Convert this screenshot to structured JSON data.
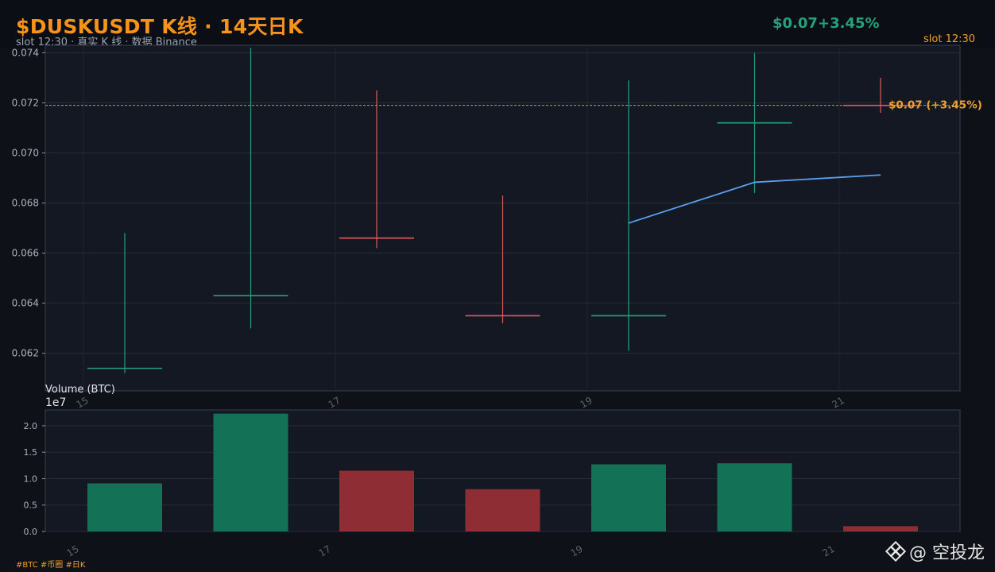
{
  "header": {
    "title": "$DUSKUSDT K线 · 14天日K",
    "subtitle": "slot 12:30 · 真实 K 线 · 数据 Binance",
    "price": "$0.07",
    "change": "+3.45%",
    "slot": "slot 12:30"
  },
  "footer": {
    "tags": "#BTC #币圈 #日K",
    "watermark": "@ 空投龙"
  },
  "colors": {
    "up": "#26a17b",
    "down": "#e05a5a",
    "up_volume": "#137256",
    "down_volume": "#8e2d34",
    "ma_line": "#5aa0f0",
    "accent": "#f0a030"
  },
  "chart_data": [
    {
      "type": "candlestick",
      "x": [
        "15",
        "16",
        "17",
        "18",
        "19",
        "20",
        "21"
      ],
      "x_tick_labels": [
        "15",
        "17",
        "19",
        "21"
      ],
      "open": [
        0.0614,
        0.0643,
        0.0666,
        0.0635,
        0.0635,
        0.0712,
        0.0719
      ],
      "high": [
        0.0668,
        0.0742,
        0.0725,
        0.0683,
        0.0729,
        0.074,
        0.073
      ],
      "low": [
        0.0612,
        0.063,
        0.0662,
        0.0632,
        0.0621,
        0.0684,
        0.0716
      ],
      "close": [
        0.0614,
        0.0643,
        0.0666,
        0.0635,
        0.0635,
        0.0712,
        0.0719
      ],
      "direction": [
        "up",
        "up",
        "down",
        "down",
        "up",
        "up",
        "down"
      ],
      "ma_line": {
        "x": [
          "19",
          "20",
          "21"
        ],
        "values": [
          0.0672,
          0.06883,
          0.06912
        ]
      },
      "current_price_line": 0.0719,
      "current_label": "$0.07  (+3.45%)",
      "ylim": [
        0.0605,
        0.0743
      ],
      "y_ticks": [
        "0.062",
        "0.064",
        "0.066",
        "0.068",
        "0.070",
        "0.072",
        "0.074"
      ],
      "grid": true
    },
    {
      "type": "bar",
      "ylabel": "Volume (BTC)",
      "y_scale_label": "1e7",
      "x": [
        "15",
        "16",
        "17",
        "18",
        "19",
        "20",
        "21"
      ],
      "values": [
        0.91,
        2.23,
        1.15,
        0.8,
        1.27,
        1.29,
        0.1
      ],
      "direction": [
        "up",
        "up",
        "down",
        "down",
        "up",
        "up",
        "down"
      ],
      "ylim": [
        0,
        2.3
      ],
      "y_ticks": [
        "0.0",
        "0.5",
        "1.0",
        "1.5",
        "2.0"
      ],
      "x_tick_labels": [
        "15",
        "17",
        "19",
        "21"
      ]
    }
  ]
}
